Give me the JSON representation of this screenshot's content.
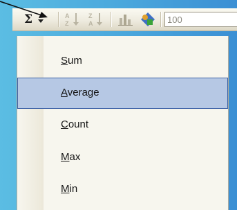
{
  "toolbar": {
    "sum_button": {
      "glyph": "Σ",
      "icon": "autosum-icon"
    },
    "dropdown_icon": "chevron-down-icon",
    "buttons": [
      {
        "icon": "sort-ascending-icon"
      },
      {
        "icon": "sort-descending-icon"
      },
      {
        "icon": "chart-wizard-icon"
      },
      {
        "icon": "drawing-icon"
      }
    ],
    "zoom_text": "100"
  },
  "menu": {
    "items": [
      {
        "access_key": "S",
        "rest": "um",
        "selected": false
      },
      {
        "access_key": "A",
        "rest": "verage",
        "selected": true
      },
      {
        "access_key": "C",
        "rest": "ount",
        "selected": false
      },
      {
        "access_key": "M",
        "rest": "ax",
        "selected": false
      },
      {
        "access_key": "M",
        "rest": "in",
        "selected": false
      }
    ]
  },
  "colors": {
    "background": "#49a6dc",
    "menu_background": "#f7f6ee",
    "highlight_fill": "#b6c8e4",
    "highlight_border": "#3c61a6"
  }
}
